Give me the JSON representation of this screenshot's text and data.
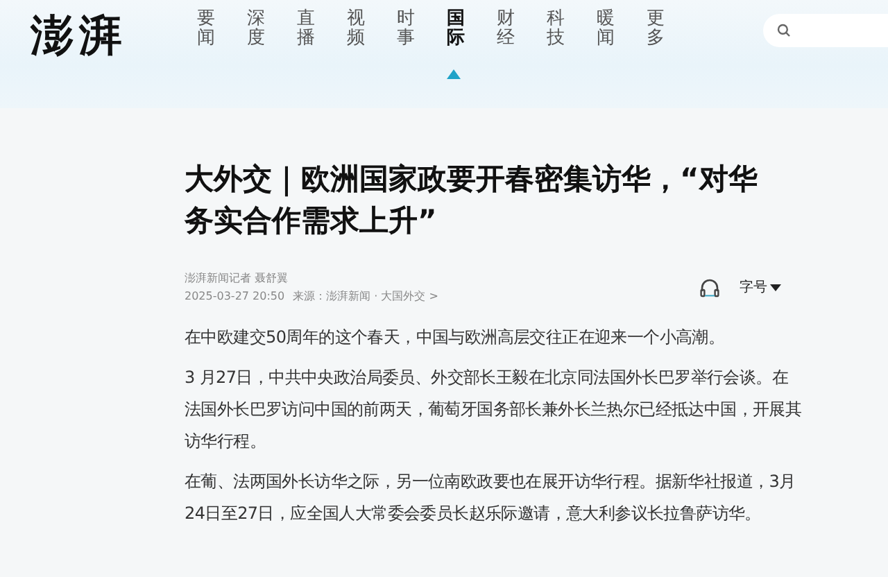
{
  "header": {
    "logo": "澎湃",
    "nav": [
      {
        "label": "要闻",
        "selected": false
      },
      {
        "label": "深度",
        "selected": false
      },
      {
        "label": "直播",
        "selected": false
      },
      {
        "label": "视频",
        "selected": false
      },
      {
        "label": "时事",
        "selected": false
      },
      {
        "label": "国际",
        "selected": true
      },
      {
        "label": "财经",
        "selected": false
      },
      {
        "label": "科技",
        "selected": false
      },
      {
        "label": "暖闻",
        "selected": false
      },
      {
        "label": "更多",
        "selected": false
      }
    ]
  },
  "article": {
    "title": "大外交｜欧洲国家政要开春密集访华，“对华务实合作需求上升”",
    "byline": "澎湃新闻记者 聂舒翼",
    "date": "2025-03-27 20:50",
    "source": "来源：澎湃新闻 · 大国外交 >",
    "font_size_label": "字号",
    "paragraphs": [
      "在中欧建交50周年的这个春天，中国与欧洲高层交往正在迎来一个小高潮。",
      " 3 月27日，中共中央政治局委员、外交部长王毅在北京同法国外长巴罗举行会谈。在法国外长巴罗访问中国的前两天，葡萄牙国务部长兼外长兰热尔已经抵达中国，开展其访华行程。",
      "在葡、法两国外长访华之际，另一位南欧政要也在展开访华行程。据新华社报道，3月24日至27日，应全国人大常委会委员长赵乐际邀请，意大利参议长拉鲁萨访华。"
    ]
  }
}
